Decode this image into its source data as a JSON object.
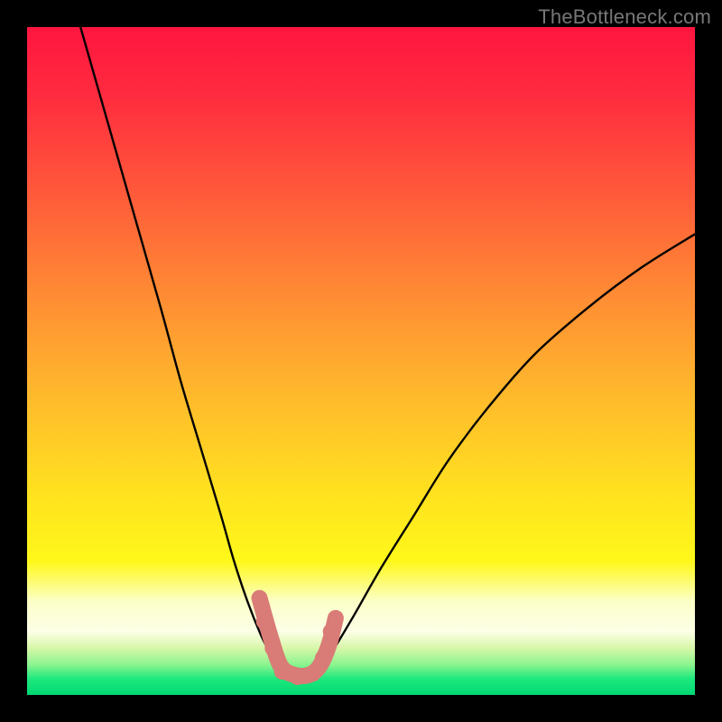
{
  "watermark": "TheBottleneck.com",
  "colors": {
    "frame": "#000000",
    "curve": "#000000",
    "marker_fill": "#d97b76",
    "bottom_band": "#00f07a",
    "gradient_stops": [
      {
        "offset": 0.0,
        "color": "#ff153f"
      },
      {
        "offset": 0.1,
        "color": "#ff2b3f"
      },
      {
        "offset": 0.25,
        "color": "#ff5a3a"
      },
      {
        "offset": 0.4,
        "color": "#ff8b34"
      },
      {
        "offset": 0.55,
        "color": "#ffb92c"
      },
      {
        "offset": 0.7,
        "color": "#ffe21f"
      },
      {
        "offset": 0.8,
        "color": "#fff81a"
      },
      {
        "offset": 0.86,
        "color": "#fbffc7"
      },
      {
        "offset": 0.905,
        "color": "#fdffe7"
      },
      {
        "offset": 0.93,
        "color": "#d7f7a8"
      },
      {
        "offset": 0.955,
        "color": "#8af48f"
      },
      {
        "offset": 0.975,
        "color": "#20e97e"
      },
      {
        "offset": 1.0,
        "color": "#00d873"
      }
    ]
  },
  "chart_data": {
    "type": "line",
    "title": "",
    "xlabel": "",
    "ylabel": "",
    "xlim": [
      0,
      100
    ],
    "ylim": [
      0,
      100
    ],
    "series": [
      {
        "name": "curve-left",
        "x": [
          8,
          12,
          16,
          20,
          23,
          26,
          29,
          31,
          33,
          35,
          36.5,
          37.5
        ],
        "y": [
          100,
          86,
          72,
          58,
          47,
          37,
          27,
          20,
          14,
          9,
          6,
          4
        ]
      },
      {
        "name": "curve-right",
        "x": [
          44,
          46,
          49,
          53,
          58,
          63,
          69,
          76,
          84,
          92,
          100
        ],
        "y": [
          4,
          7,
          12,
          19,
          27,
          35,
          43,
          51,
          58,
          64,
          69
        ]
      },
      {
        "name": "valley-floor",
        "x": [
          37.5,
          39,
          41,
          43,
          44
        ],
        "y": [
          4,
          2.8,
          2.5,
          2.8,
          4
        ]
      }
    ],
    "markers": [
      {
        "x": 35.5,
        "y": 11
      },
      {
        "x": 36.8,
        "y": 7
      },
      {
        "x": 38.2,
        "y": 3.5
      },
      {
        "x": 40.5,
        "y": 2.7
      },
      {
        "x": 42.8,
        "y": 3.2
      },
      {
        "x": 44.3,
        "y": 5.5
      },
      {
        "x": 45.5,
        "y": 9.5
      }
    ],
    "floor_path_pct": [
      {
        "x": 34.8,
        "y": 14.5
      },
      {
        "x": 36.5,
        "y": 8.5
      },
      {
        "x": 38.0,
        "y": 4.3
      },
      {
        "x": 40.0,
        "y": 3.0
      },
      {
        "x": 42.2,
        "y": 3.0
      },
      {
        "x": 43.8,
        "y": 4.3
      },
      {
        "x": 45.2,
        "y": 7.5
      },
      {
        "x": 46.2,
        "y": 11.5
      }
    ]
  }
}
